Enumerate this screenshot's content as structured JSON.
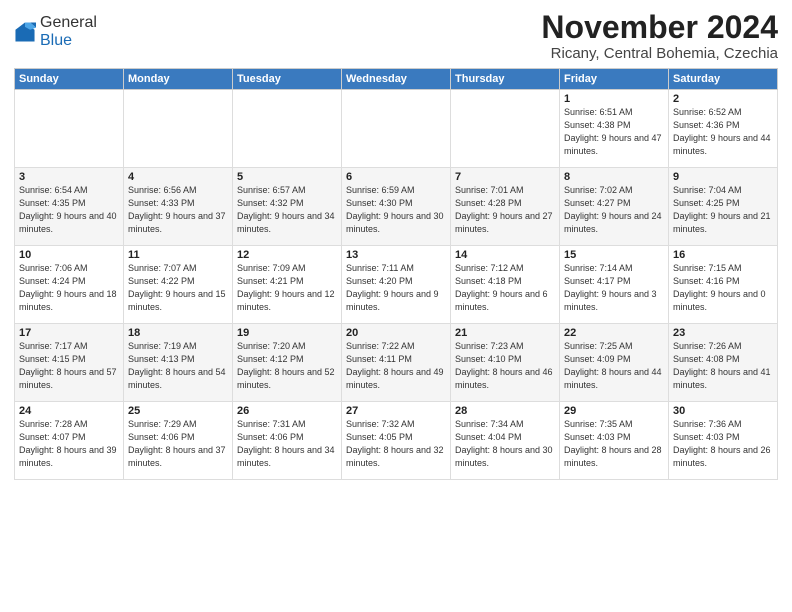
{
  "logo": {
    "general": "General",
    "blue": "Blue"
  },
  "title": "November 2024",
  "subtitle": "Ricany, Central Bohemia, Czechia",
  "days_of_week": [
    "Sunday",
    "Monday",
    "Tuesday",
    "Wednesday",
    "Thursday",
    "Friday",
    "Saturday"
  ],
  "weeks": [
    [
      {
        "day": "",
        "info": ""
      },
      {
        "day": "",
        "info": ""
      },
      {
        "day": "",
        "info": ""
      },
      {
        "day": "",
        "info": ""
      },
      {
        "day": "",
        "info": ""
      },
      {
        "day": "1",
        "info": "Sunrise: 6:51 AM\nSunset: 4:38 PM\nDaylight: 9 hours and 47 minutes."
      },
      {
        "day": "2",
        "info": "Sunrise: 6:52 AM\nSunset: 4:36 PM\nDaylight: 9 hours and 44 minutes."
      }
    ],
    [
      {
        "day": "3",
        "info": "Sunrise: 6:54 AM\nSunset: 4:35 PM\nDaylight: 9 hours and 40 minutes."
      },
      {
        "day": "4",
        "info": "Sunrise: 6:56 AM\nSunset: 4:33 PM\nDaylight: 9 hours and 37 minutes."
      },
      {
        "day": "5",
        "info": "Sunrise: 6:57 AM\nSunset: 4:32 PM\nDaylight: 9 hours and 34 minutes."
      },
      {
        "day": "6",
        "info": "Sunrise: 6:59 AM\nSunset: 4:30 PM\nDaylight: 9 hours and 30 minutes."
      },
      {
        "day": "7",
        "info": "Sunrise: 7:01 AM\nSunset: 4:28 PM\nDaylight: 9 hours and 27 minutes."
      },
      {
        "day": "8",
        "info": "Sunrise: 7:02 AM\nSunset: 4:27 PM\nDaylight: 9 hours and 24 minutes."
      },
      {
        "day": "9",
        "info": "Sunrise: 7:04 AM\nSunset: 4:25 PM\nDaylight: 9 hours and 21 minutes."
      }
    ],
    [
      {
        "day": "10",
        "info": "Sunrise: 7:06 AM\nSunset: 4:24 PM\nDaylight: 9 hours and 18 minutes."
      },
      {
        "day": "11",
        "info": "Sunrise: 7:07 AM\nSunset: 4:22 PM\nDaylight: 9 hours and 15 minutes."
      },
      {
        "day": "12",
        "info": "Sunrise: 7:09 AM\nSunset: 4:21 PM\nDaylight: 9 hours and 12 minutes."
      },
      {
        "day": "13",
        "info": "Sunrise: 7:11 AM\nSunset: 4:20 PM\nDaylight: 9 hours and 9 minutes."
      },
      {
        "day": "14",
        "info": "Sunrise: 7:12 AM\nSunset: 4:18 PM\nDaylight: 9 hours and 6 minutes."
      },
      {
        "day": "15",
        "info": "Sunrise: 7:14 AM\nSunset: 4:17 PM\nDaylight: 9 hours and 3 minutes."
      },
      {
        "day": "16",
        "info": "Sunrise: 7:15 AM\nSunset: 4:16 PM\nDaylight: 9 hours and 0 minutes."
      }
    ],
    [
      {
        "day": "17",
        "info": "Sunrise: 7:17 AM\nSunset: 4:15 PM\nDaylight: 8 hours and 57 minutes."
      },
      {
        "day": "18",
        "info": "Sunrise: 7:19 AM\nSunset: 4:13 PM\nDaylight: 8 hours and 54 minutes."
      },
      {
        "day": "19",
        "info": "Sunrise: 7:20 AM\nSunset: 4:12 PM\nDaylight: 8 hours and 52 minutes."
      },
      {
        "day": "20",
        "info": "Sunrise: 7:22 AM\nSunset: 4:11 PM\nDaylight: 8 hours and 49 minutes."
      },
      {
        "day": "21",
        "info": "Sunrise: 7:23 AM\nSunset: 4:10 PM\nDaylight: 8 hours and 46 minutes."
      },
      {
        "day": "22",
        "info": "Sunrise: 7:25 AM\nSunset: 4:09 PM\nDaylight: 8 hours and 44 minutes."
      },
      {
        "day": "23",
        "info": "Sunrise: 7:26 AM\nSunset: 4:08 PM\nDaylight: 8 hours and 41 minutes."
      }
    ],
    [
      {
        "day": "24",
        "info": "Sunrise: 7:28 AM\nSunset: 4:07 PM\nDaylight: 8 hours and 39 minutes."
      },
      {
        "day": "25",
        "info": "Sunrise: 7:29 AM\nSunset: 4:06 PM\nDaylight: 8 hours and 37 minutes."
      },
      {
        "day": "26",
        "info": "Sunrise: 7:31 AM\nSunset: 4:06 PM\nDaylight: 8 hours and 34 minutes."
      },
      {
        "day": "27",
        "info": "Sunrise: 7:32 AM\nSunset: 4:05 PM\nDaylight: 8 hours and 32 minutes."
      },
      {
        "day": "28",
        "info": "Sunrise: 7:34 AM\nSunset: 4:04 PM\nDaylight: 8 hours and 30 minutes."
      },
      {
        "day": "29",
        "info": "Sunrise: 7:35 AM\nSunset: 4:03 PM\nDaylight: 8 hours and 28 minutes."
      },
      {
        "day": "30",
        "info": "Sunrise: 7:36 AM\nSunset: 4:03 PM\nDaylight: 8 hours and 26 minutes."
      }
    ]
  ]
}
